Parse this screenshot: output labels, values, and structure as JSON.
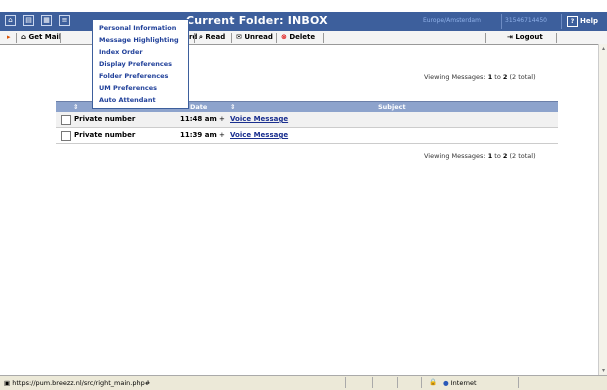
{
  "header": {
    "title": "Current Folder: INBOX",
    "timezone": "Europe/Amsterdam",
    "phone": "31546714450",
    "help_label": "Help",
    "help_glyph": "?",
    "icons": [
      "home-icon",
      "grid-icon",
      "list-icon",
      "menu-icon"
    ]
  },
  "menu": {
    "items": [
      "Personal Information",
      "Message Highlighting",
      "Index Order",
      "Display Preferences",
      "Folder Preferences",
      "UM Preferences",
      "Auto Attendant"
    ]
  },
  "toolbar": {
    "get_mail": "Get Mail",
    "forward": "Forward",
    "read": "Read",
    "unread": "Unread",
    "delete": "Delete",
    "logout": "Logout"
  },
  "viewing": {
    "prefix": "Viewing Messages: ",
    "from": "1",
    "to_word": " to ",
    "to": "2",
    "suffix": " (2 total)"
  },
  "table": {
    "columns": {
      "from": "From",
      "date": "Date",
      "subject": "Subject"
    },
    "rows": [
      {
        "from": "Private number",
        "date": "11:48 am",
        "sep": "+",
        "subject": "Voice Message"
      },
      {
        "from": "Private number",
        "date": "11:39 am",
        "sep": "+",
        "subject": "Voice Message"
      }
    ]
  },
  "statusbar": {
    "url": "https://pum.breezz.nl/src/right_main.php#",
    "zone": "Internet"
  },
  "colors": {
    "header_bg": "#3d5f9c",
    "table_header_bg": "#8da3cc",
    "link": "#1a2f8f"
  }
}
